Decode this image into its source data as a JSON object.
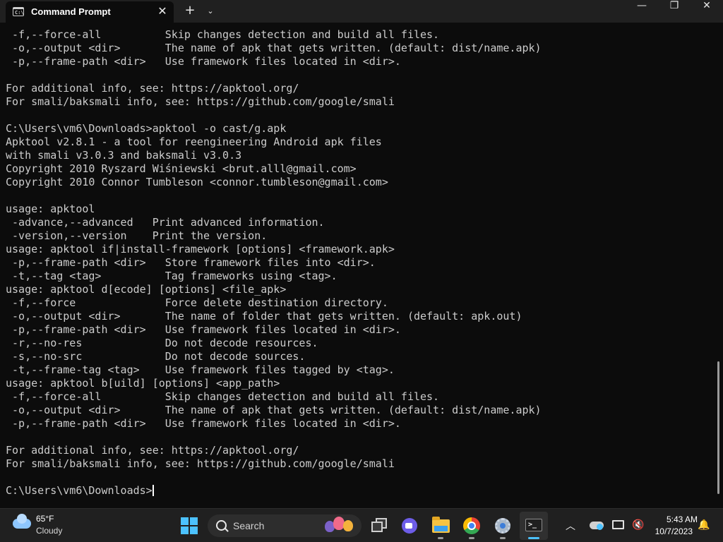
{
  "window": {
    "tab_title": "Command Prompt",
    "tab_icon_text": "C:\\",
    "close_tab": "✕",
    "new_tab": "+",
    "tab_menu": "⌄",
    "minimize": "—",
    "maximize": "❐",
    "close": "✕"
  },
  "terminal": {
    "content": " -f,--force-all          Skip changes detection and build all files.\n -o,--output <dir>       The name of apk that gets written. (default: dist/name.apk)\n -p,--frame-path <dir>   Use framework files located in <dir>.\n\nFor additional info, see: https://apktool.org/\nFor smali/baksmali info, see: https://github.com/google/smali\n\nC:\\Users\\vm6\\Downloads>apktool -o cast/g.apk\nApktool v2.8.1 - a tool for reengineering Android apk files\nwith smali v3.0.3 and baksmali v3.0.3\nCopyright 2010 Ryszard Wiśniewski <brut.alll@gmail.com>\nCopyright 2010 Connor Tumbleson <connor.tumbleson@gmail.com>\n\nusage: apktool\n -advance,--advanced   Print advanced information.\n -version,--version    Print the version.\nusage: apktool if|install-framework [options] <framework.apk>\n -p,--frame-path <dir>   Store framework files into <dir>.\n -t,--tag <tag>          Tag frameworks using <tag>.\nusage: apktool d[ecode] [options] <file_apk>\n -f,--force              Force delete destination directory.\n -o,--output <dir>       The name of folder that gets written. (default: apk.out)\n -p,--frame-path <dir>   Use framework files located in <dir>.\n -r,--no-res             Do not decode resources.\n -s,--no-src             Do not decode sources.\n -t,--frame-tag <tag>    Use framework files tagged by <tag>.\nusage: apktool b[uild] [options] <app_path>\n -f,--force-all          Skip changes detection and build all files.\n -o,--output <dir>       The name of apk that gets written. (default: dist/name.apk)\n -p,--frame-path <dir>   Use framework files located in <dir>.\n\nFor additional info, see: https://apktool.org/\nFor smali/baksmali info, see: https://github.com/google/smali\n\n",
    "prompt": "C:\\Users\\vm6\\Downloads>"
  },
  "taskbar": {
    "weather": {
      "temp": "65°F",
      "condition": "Cloudy",
      "icon": "cloud-icon"
    },
    "search_label": "Search",
    "apps": [
      "task-view",
      "teams-meet",
      "file-explorer",
      "chrome",
      "settings",
      "terminal"
    ],
    "active_app": "terminal",
    "tray_chevron": "︿",
    "volume_glyph": "🔇",
    "bell_glyph": "🔔",
    "clock": {
      "time": "5:43 AM",
      "date": "10/7/2023"
    }
  },
  "colors": {
    "terminal_bg": "#0c0c0c",
    "terminal_fg": "#cccccc",
    "titlebar_bg": "#202020",
    "taskbar_bg": "#202020",
    "accent": "#4cc2ff"
  }
}
